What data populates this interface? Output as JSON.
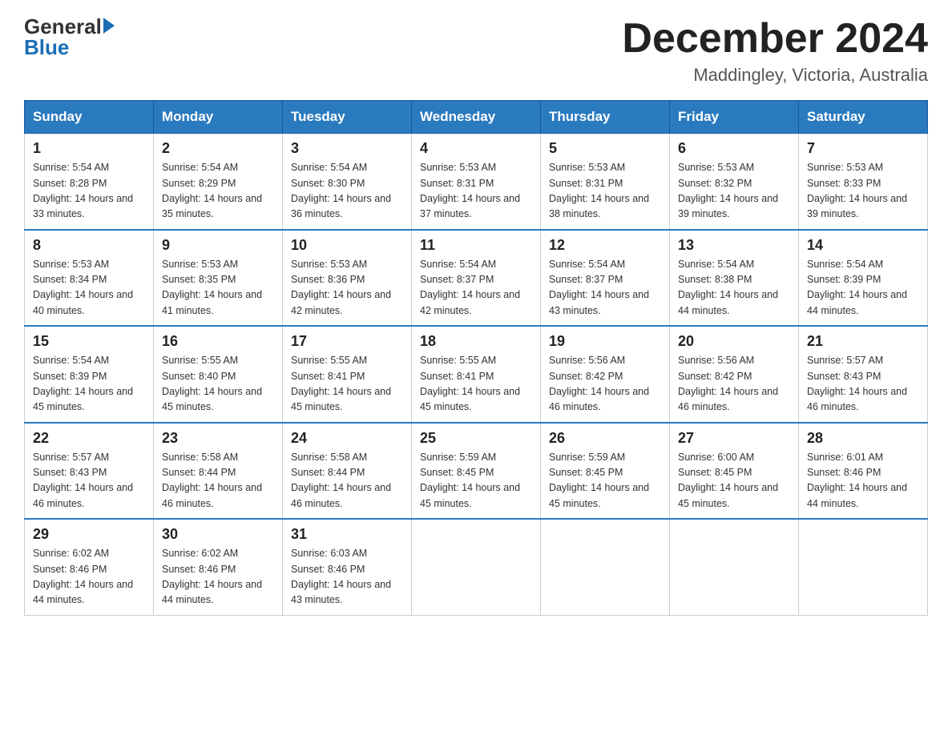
{
  "header": {
    "logo_general": "General",
    "logo_blue": "Blue",
    "month_title": "December 2024",
    "location": "Maddingley, Victoria, Australia"
  },
  "weekdays": [
    "Sunday",
    "Monday",
    "Tuesday",
    "Wednesday",
    "Thursday",
    "Friday",
    "Saturday"
  ],
  "weeks": [
    [
      {
        "day": "1",
        "sunrise": "5:54 AM",
        "sunset": "8:28 PM",
        "daylight": "14 hours and 33 minutes."
      },
      {
        "day": "2",
        "sunrise": "5:54 AM",
        "sunset": "8:29 PM",
        "daylight": "14 hours and 35 minutes."
      },
      {
        "day": "3",
        "sunrise": "5:54 AM",
        "sunset": "8:30 PM",
        "daylight": "14 hours and 36 minutes."
      },
      {
        "day": "4",
        "sunrise": "5:53 AM",
        "sunset": "8:31 PM",
        "daylight": "14 hours and 37 minutes."
      },
      {
        "day": "5",
        "sunrise": "5:53 AM",
        "sunset": "8:31 PM",
        "daylight": "14 hours and 38 minutes."
      },
      {
        "day": "6",
        "sunrise": "5:53 AM",
        "sunset": "8:32 PM",
        "daylight": "14 hours and 39 minutes."
      },
      {
        "day": "7",
        "sunrise": "5:53 AM",
        "sunset": "8:33 PM",
        "daylight": "14 hours and 39 minutes."
      }
    ],
    [
      {
        "day": "8",
        "sunrise": "5:53 AM",
        "sunset": "8:34 PM",
        "daylight": "14 hours and 40 minutes."
      },
      {
        "day": "9",
        "sunrise": "5:53 AM",
        "sunset": "8:35 PM",
        "daylight": "14 hours and 41 minutes."
      },
      {
        "day": "10",
        "sunrise": "5:53 AM",
        "sunset": "8:36 PM",
        "daylight": "14 hours and 42 minutes."
      },
      {
        "day": "11",
        "sunrise": "5:54 AM",
        "sunset": "8:37 PM",
        "daylight": "14 hours and 42 minutes."
      },
      {
        "day": "12",
        "sunrise": "5:54 AM",
        "sunset": "8:37 PM",
        "daylight": "14 hours and 43 minutes."
      },
      {
        "day": "13",
        "sunrise": "5:54 AM",
        "sunset": "8:38 PM",
        "daylight": "14 hours and 44 minutes."
      },
      {
        "day": "14",
        "sunrise": "5:54 AM",
        "sunset": "8:39 PM",
        "daylight": "14 hours and 44 minutes."
      }
    ],
    [
      {
        "day": "15",
        "sunrise": "5:54 AM",
        "sunset": "8:39 PM",
        "daylight": "14 hours and 45 minutes."
      },
      {
        "day": "16",
        "sunrise": "5:55 AM",
        "sunset": "8:40 PM",
        "daylight": "14 hours and 45 minutes."
      },
      {
        "day": "17",
        "sunrise": "5:55 AM",
        "sunset": "8:41 PM",
        "daylight": "14 hours and 45 minutes."
      },
      {
        "day": "18",
        "sunrise": "5:55 AM",
        "sunset": "8:41 PM",
        "daylight": "14 hours and 45 minutes."
      },
      {
        "day": "19",
        "sunrise": "5:56 AM",
        "sunset": "8:42 PM",
        "daylight": "14 hours and 46 minutes."
      },
      {
        "day": "20",
        "sunrise": "5:56 AM",
        "sunset": "8:42 PM",
        "daylight": "14 hours and 46 minutes."
      },
      {
        "day": "21",
        "sunrise": "5:57 AM",
        "sunset": "8:43 PM",
        "daylight": "14 hours and 46 minutes."
      }
    ],
    [
      {
        "day": "22",
        "sunrise": "5:57 AM",
        "sunset": "8:43 PM",
        "daylight": "14 hours and 46 minutes."
      },
      {
        "day": "23",
        "sunrise": "5:58 AM",
        "sunset": "8:44 PM",
        "daylight": "14 hours and 46 minutes."
      },
      {
        "day": "24",
        "sunrise": "5:58 AM",
        "sunset": "8:44 PM",
        "daylight": "14 hours and 46 minutes."
      },
      {
        "day": "25",
        "sunrise": "5:59 AM",
        "sunset": "8:45 PM",
        "daylight": "14 hours and 45 minutes."
      },
      {
        "day": "26",
        "sunrise": "5:59 AM",
        "sunset": "8:45 PM",
        "daylight": "14 hours and 45 minutes."
      },
      {
        "day": "27",
        "sunrise": "6:00 AM",
        "sunset": "8:45 PM",
        "daylight": "14 hours and 45 minutes."
      },
      {
        "day": "28",
        "sunrise": "6:01 AM",
        "sunset": "8:46 PM",
        "daylight": "14 hours and 44 minutes."
      }
    ],
    [
      {
        "day": "29",
        "sunrise": "6:02 AM",
        "sunset": "8:46 PM",
        "daylight": "14 hours and 44 minutes."
      },
      {
        "day": "30",
        "sunrise": "6:02 AM",
        "sunset": "8:46 PM",
        "daylight": "14 hours and 44 minutes."
      },
      {
        "day": "31",
        "sunrise": "6:03 AM",
        "sunset": "8:46 PM",
        "daylight": "14 hours and 43 minutes."
      },
      null,
      null,
      null,
      null
    ]
  ],
  "labels": {
    "sunrise_prefix": "Sunrise: ",
    "sunset_prefix": "Sunset: ",
    "daylight_prefix": "Daylight: "
  }
}
